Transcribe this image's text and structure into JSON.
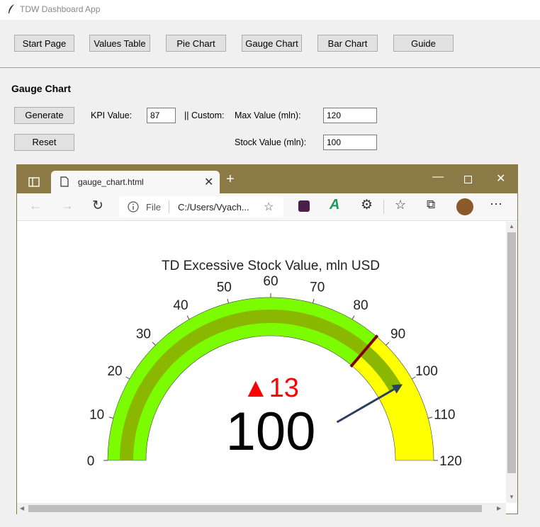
{
  "app": {
    "title": "TDW Dashboard App"
  },
  "nav": {
    "start_page": "Start Page",
    "values_table": "Values Table",
    "pie_chart": "Pie Chart",
    "gauge_chart": "Gauge Chart",
    "bar_chart": "Bar Chart",
    "guide": "Guide"
  },
  "section": {
    "title": "Gauge Chart"
  },
  "controls": {
    "generate": "Generate",
    "reset": "Reset",
    "kpi_label": "KPI Value:",
    "kpi_value": "87",
    "custom_label": "|| Custom:",
    "max_label": "Max Value (mln):",
    "max_value": "120",
    "stock_label": "Stock Value (mln):",
    "stock_value": "100"
  },
  "browser": {
    "tab_title": "gauge_chart.html",
    "file_label": "File",
    "url": "C:/Users/Vyach..."
  },
  "chart_data": {
    "type": "gauge",
    "title": "TD Excessive Stock Value, mln USD",
    "range": [
      0,
      120
    ],
    "ticks": [
      0,
      10,
      20,
      30,
      40,
      50,
      60,
      70,
      80,
      90,
      100,
      110,
      120
    ],
    "value": 100,
    "delta": "13",
    "delta_symbol": "▲",
    "reference": 87,
    "threshold": 87,
    "steps": [
      {
        "range": [
          0,
          87
        ],
        "color": "#7cfc00"
      },
      {
        "range": [
          87,
          120
        ],
        "color": "#ffff00"
      }
    ],
    "bar_color": "#8ab800",
    "threshold_color": "#800000",
    "needle_color": "#2a3f5f",
    "delta_color": "#ff0000"
  }
}
